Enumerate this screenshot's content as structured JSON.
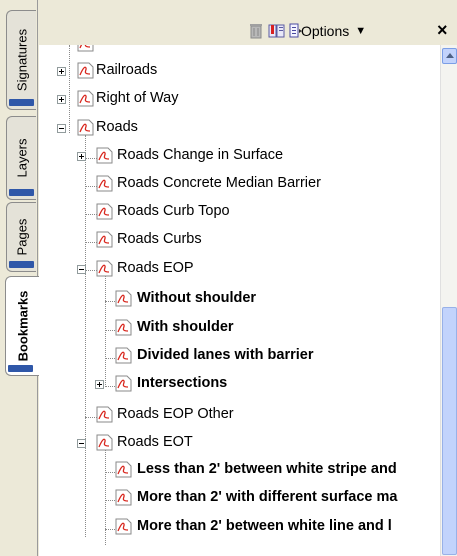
{
  "side_tabs": [
    "Signatures",
    "Layers",
    "Pages",
    "Bookmarks"
  ],
  "toolbar": {
    "options_label": "Options",
    "close_label": "×"
  },
  "tree": [
    {
      "label": "Railroads",
      "bold": false
    },
    {
      "label": "Right of Way",
      "bold": false
    },
    {
      "label": "Roads",
      "bold": false
    },
    {
      "label": "Roads Change in Surface",
      "bold": false
    },
    {
      "label": "Roads Concrete Median Barrier",
      "bold": false
    },
    {
      "label": "Roads Curb Topo",
      "bold": false
    },
    {
      "label": "Roads Curbs",
      "bold": false
    },
    {
      "label": "Roads EOP",
      "bold": false
    },
    {
      "label": "Without shoulder",
      "bold": true
    },
    {
      "label": "With shoulder",
      "bold": true
    },
    {
      "label": "Divided lanes with barrier",
      "bold": true
    },
    {
      "label": "Intersections",
      "bold": true
    },
    {
      "label": "Roads EOP Other",
      "bold": false
    },
    {
      "label": "Roads EOT",
      "bold": false
    },
    {
      "label": "Less than 2' between white stripe and",
      "bold": true
    },
    {
      "label": "More than 2' with different surface ma",
      "bold": true
    },
    {
      "label": "More than 2' between white line and l",
      "bold": true
    }
  ],
  "colors": {
    "tab_bar": "#2f57a8",
    "pdf_red": "#d8261d",
    "scroll": "#c2d3fc"
  }
}
